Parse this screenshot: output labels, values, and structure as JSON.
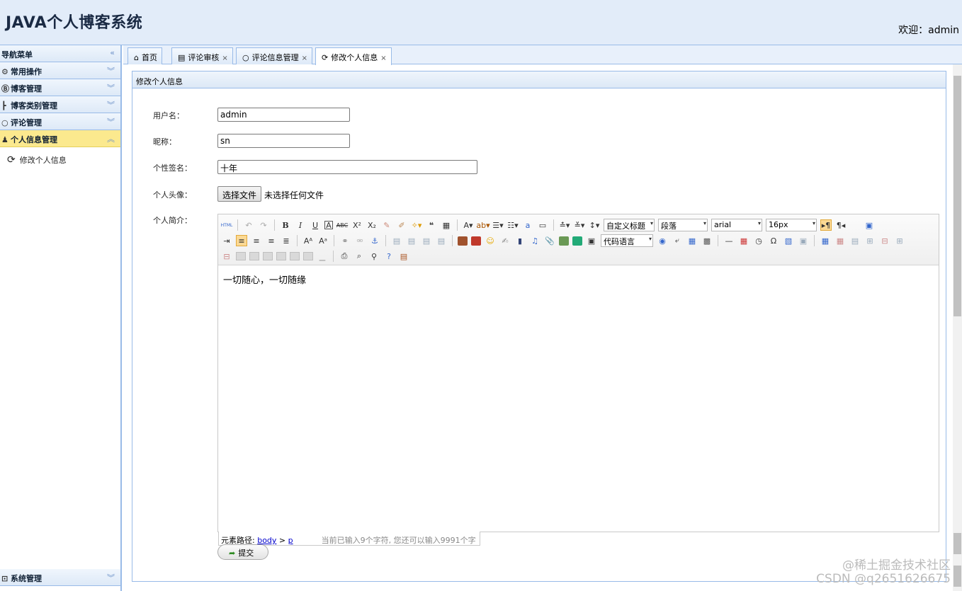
{
  "header": {
    "logo": "JAVA个人博客系统",
    "welcome_label": "欢迎：",
    "user": "admin"
  },
  "sidebar": {
    "title": "导航菜单",
    "sections": [
      {
        "label": "常用操作",
        "icon": "gear-icon"
      },
      {
        "label": "博客管理",
        "icon": "blog-icon"
      },
      {
        "label": "博客类别管理",
        "icon": "category-icon"
      },
      {
        "label": "评论管理",
        "icon": "comment-icon"
      },
      {
        "label": "个人信息管理",
        "icon": "user-icon"
      }
    ],
    "sub_items": [
      {
        "label": "修改个人信息",
        "icon": "refresh-icon"
      }
    ],
    "bottom": {
      "label": "系统管理",
      "icon": "system-icon"
    }
  },
  "tabs": [
    {
      "label": "首页",
      "icon": "home-icon",
      "closable": false
    },
    {
      "label": "评论审核",
      "icon": "comment-review-icon",
      "closable": true
    },
    {
      "label": "评论信息管理",
      "icon": "comment-icon",
      "closable": true
    },
    {
      "label": "修改个人信息",
      "icon": "refresh-icon",
      "closable": true
    }
  ],
  "form": {
    "panel_title": "修改个人信息",
    "username_label": "用户名：",
    "username": "admin",
    "nickname_label": "昵称：",
    "nickname": "sn",
    "sign_label": "个性签名：",
    "sign": "十年",
    "avatar_label": "个人头像：",
    "file_button": "选择文件",
    "file_status": "未选择任何文件",
    "profile_label": "个人简介：",
    "submit": "提交"
  },
  "editor": {
    "content": "一切随心，一切随缘",
    "custom_heading": "自定义标题",
    "paragraph": "段落",
    "font": "arial",
    "size": "16px",
    "code_lang": "代码语言",
    "status_label": "元素路径:",
    "path_body": "body",
    "path_sep": " > ",
    "path_p": "p",
    "count": "当前已输入9个字符, 您还可以输入9991个字符。"
  },
  "watermark": {
    "line1": "@稀土掘金技术社区",
    "line2": "CSDN @q2651626675"
  }
}
